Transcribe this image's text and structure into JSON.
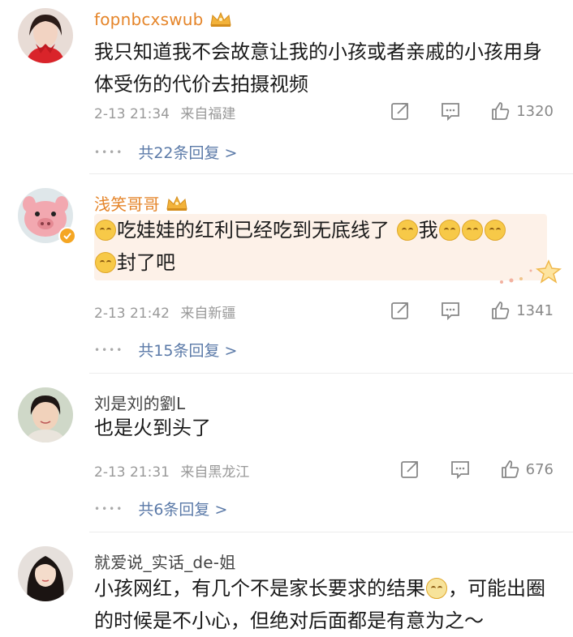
{
  "comments": [
    {
      "username": "fopnbcxswub",
      "text": "我只知道我不会故意让我的小孩或者亲戚的小孩用身体受伤的代价去拍摄视频",
      "time": "2-13 21:34",
      "location": "来自福建",
      "likes": "1320",
      "replies": "共22条回复 >"
    },
    {
      "username": "浅笑哥哥",
      "text_parts": [
        "吃娃娃的红利已经吃到无底线了",
        "我",
        "封了吧"
      ],
      "time": "2-13 21:42",
      "location": "来自新疆",
      "likes": "1341",
      "replies": "共15条回复 >"
    },
    {
      "username": "刘是刘的劉L",
      "text": "也是火到头了",
      "time": "2-13 21:31",
      "location": "来自黑龙江",
      "likes": "676",
      "replies": "共6条回复 >"
    },
    {
      "username": "就爱说_实话_de-姐",
      "text_parts": [
        "小孩网红，有几个不是家长要求的结果",
        "，可能出圈的时候是不小心，但绝对后面都是有意为之～"
      ]
    }
  ],
  "icons": {
    "share": "share-icon",
    "comment": "comment-icon",
    "like": "thumbs-up-icon",
    "crown": "crown-icon",
    "verified": "verified-badge-icon"
  },
  "colors": {
    "gold_name": "#e5852a",
    "link_blue": "#5b7aa8",
    "meta_gray": "#999999",
    "bubble_bg": "#fdf1e8"
  }
}
